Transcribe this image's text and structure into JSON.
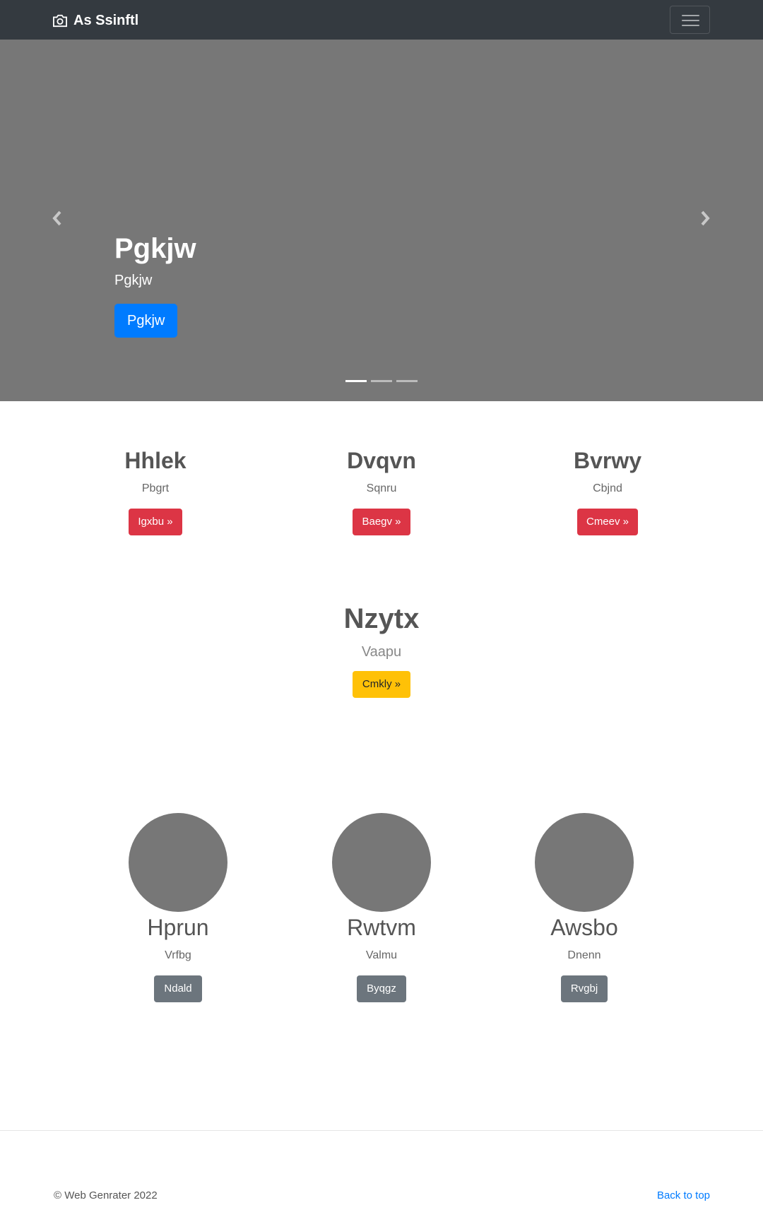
{
  "navbar": {
    "brand": "As Ssinftl",
    "brand_icon": "camera-icon",
    "toggler_icon": "hamburger-icon"
  },
  "carousel": {
    "title": "Pgkjw",
    "subtitle": "Pgkjw",
    "button": "Pgkjw",
    "indicators": 3,
    "active_index": 0,
    "background": "#777777"
  },
  "columns": [
    {
      "title": "Hhlek",
      "text": "Pbgrt",
      "button": "Igxbu »"
    },
    {
      "title": "Dvqvn",
      "text": "Sqnru",
      "button": "Baegv »"
    },
    {
      "title": "Bvrwy",
      "text": "Cbjnd",
      "button": "Cmeev »"
    }
  ],
  "featurette": {
    "title": "Nzytx",
    "text": "Vaapu",
    "button": "Cmkly »"
  },
  "circles": [
    {
      "title": "Hprun",
      "text": "Vrfbg",
      "button": "Ndald"
    },
    {
      "title": "Rwtvm",
      "text": "Valmu",
      "button": "Byqgz"
    },
    {
      "title": "Awsbo",
      "text": "Dnenn",
      "button": "Rvgbj"
    }
  ],
  "footer": {
    "copyright": "© Web Genrater 2022",
    "back_to_top": "Back to top"
  },
  "colors": {
    "navbar": "#343a40",
    "primary": "#007bff",
    "danger": "#dc3545",
    "warning": "#ffc107",
    "secondary": "#6c757d"
  }
}
